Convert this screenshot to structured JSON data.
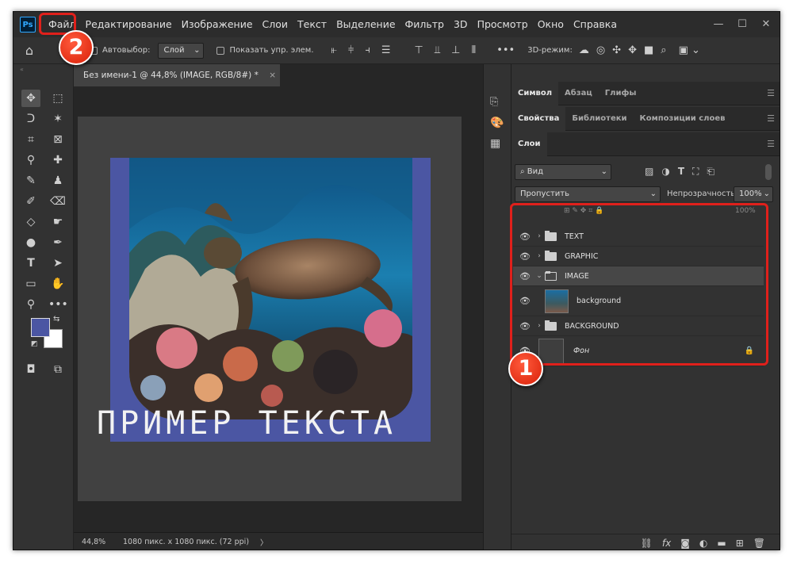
{
  "app": {
    "logo": "Ps"
  },
  "menu": [
    "Файл",
    "Редактирование",
    "Изображение",
    "Слои",
    "Текст",
    "Выделение",
    "Фильтр",
    "3D",
    "Просмотр",
    "Окно",
    "Справка"
  ],
  "window_controls": {
    "minimize": "—",
    "maximize": "☐",
    "close": "✕"
  },
  "options": {
    "autoselect_label": "Автовыбор:",
    "autoselect_value": "Слой",
    "show_controls_label": "Показать упр. элем.",
    "mode3d_label": "3D-режим:",
    "more": "•••"
  },
  "document": {
    "tab_title": "Без имени-1 @ 44,8% (IMAGE, RGB/8#) *",
    "tab_close": "×",
    "canvas_text": "ПРИМЕР ТЕКСТА",
    "zoom": "44,8%",
    "dimensions": "1080 пикс. x 1080 пикс. (72 ppi)",
    "status_arrow": "〉"
  },
  "panels": {
    "row1_tabs": [
      "Символ",
      "Абзац",
      "Глифы"
    ],
    "row2_tabs": [
      "Свойства",
      "Библиотеки",
      "Композиции слоев"
    ],
    "row3_tabs": [
      "Слои"
    ],
    "filter_kind": "Вид",
    "blend_mode": "Пропустить",
    "opacity_label": "Непрозрачность:",
    "opacity_value": "100%",
    "fill_value": "100%"
  },
  "layers": [
    {
      "name": "TEXT",
      "type": "group",
      "expanded": false
    },
    {
      "name": "GRAPHIC",
      "type": "group",
      "expanded": false
    },
    {
      "name": "IMAGE",
      "type": "group",
      "expanded": true
    },
    {
      "name": "background",
      "type": "smart-object",
      "child": true
    },
    {
      "name": "BACKGROUND",
      "type": "group",
      "expanded": false
    },
    {
      "name": "Фон",
      "type": "background",
      "locked": true
    }
  ],
  "annotations": {
    "badge1": "1",
    "badge2": "2"
  },
  "colors": {
    "accent_red": "#e0201b",
    "artboard_blue": "#4b56a3",
    "foreground": "#4b56a3",
    "background": "#ffffff"
  }
}
